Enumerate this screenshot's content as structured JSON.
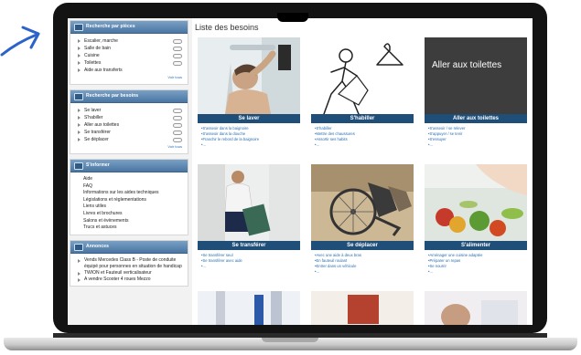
{
  "colors": {
    "accent_blue": "#1f4e79",
    "link": "#2a6fb2",
    "arrow": "#2c63c9",
    "panel_head": "#4a76a3"
  },
  "icons": [
    "hand-drawn-arrow-icon",
    "panel-icon",
    "expand-triangle-icon",
    "toggle-icon",
    "bullet-icon",
    "camera-notch"
  ],
  "sidebar": {
    "panel_pieces": {
      "title": "Recherche par pièces",
      "items": [
        "Escalier, marche",
        "Salle de bain",
        "Cuisine",
        "Toilettes",
        "Aide aux transferts"
      ],
      "more": "Voir tous"
    },
    "panel_besoins": {
      "title": "Recherche par besoins",
      "items": [
        "Se laver",
        "S'habiller",
        "Aller aux toilettes",
        "Se transférer",
        "Se déplacer"
      ],
      "more": "Voir tous"
    },
    "panel_info": {
      "title": "S'informer",
      "items": [
        "Aide",
        "FAQ",
        "Informations sur les aides techniques",
        "Législations et réglementations",
        "Liens utiles",
        "Livres et brochures",
        "Salons et évènements",
        "Trucs et astuces"
      ]
    },
    "panel_annonces": {
      "title": "Annonces",
      "items": [
        "Vends Mercedes Class B - Poste de conduite équipé pour personnes en situation de handicap",
        "TWION et Fauteuil verticalisateur",
        "A vendre Scooter 4 roues Mezzo"
      ]
    }
  },
  "main": {
    "title": "Liste des besoins",
    "cards": [
      {
        "label": "Se laver",
        "links": [
          "S'asseoir dans la baignoire",
          "S'asseoir dans la douche",
          "Franchir le rebord de la baignoire",
          "..."
        ]
      },
      {
        "label": "S'habiller",
        "links": [
          "S'habiller",
          "Mettre des chaussures",
          "Assortir ses habits",
          "..."
        ]
      },
      {
        "label": "Aller aux toilettes",
        "overlay": "Aller aux toilettes",
        "links": [
          "S'asseoir / se relever",
          "S'appuyer / se tenir",
          "S'essuyer",
          "..."
        ]
      },
      {
        "label": "Se transférer",
        "links": [
          "Se transférer seul",
          "Se transférer avec aide",
          "..."
        ]
      },
      {
        "label": "Se déplacer",
        "links": [
          "Avec une aide à deux bras",
          "En fauteuil roulant",
          "Entrer dans un véhicule",
          "..."
        ]
      },
      {
        "label": "S'alimenter",
        "links": [
          "Aménager une cuisine adaptée",
          "Préparer un repas",
          "Se nourrir",
          "..."
        ]
      }
    ]
  }
}
